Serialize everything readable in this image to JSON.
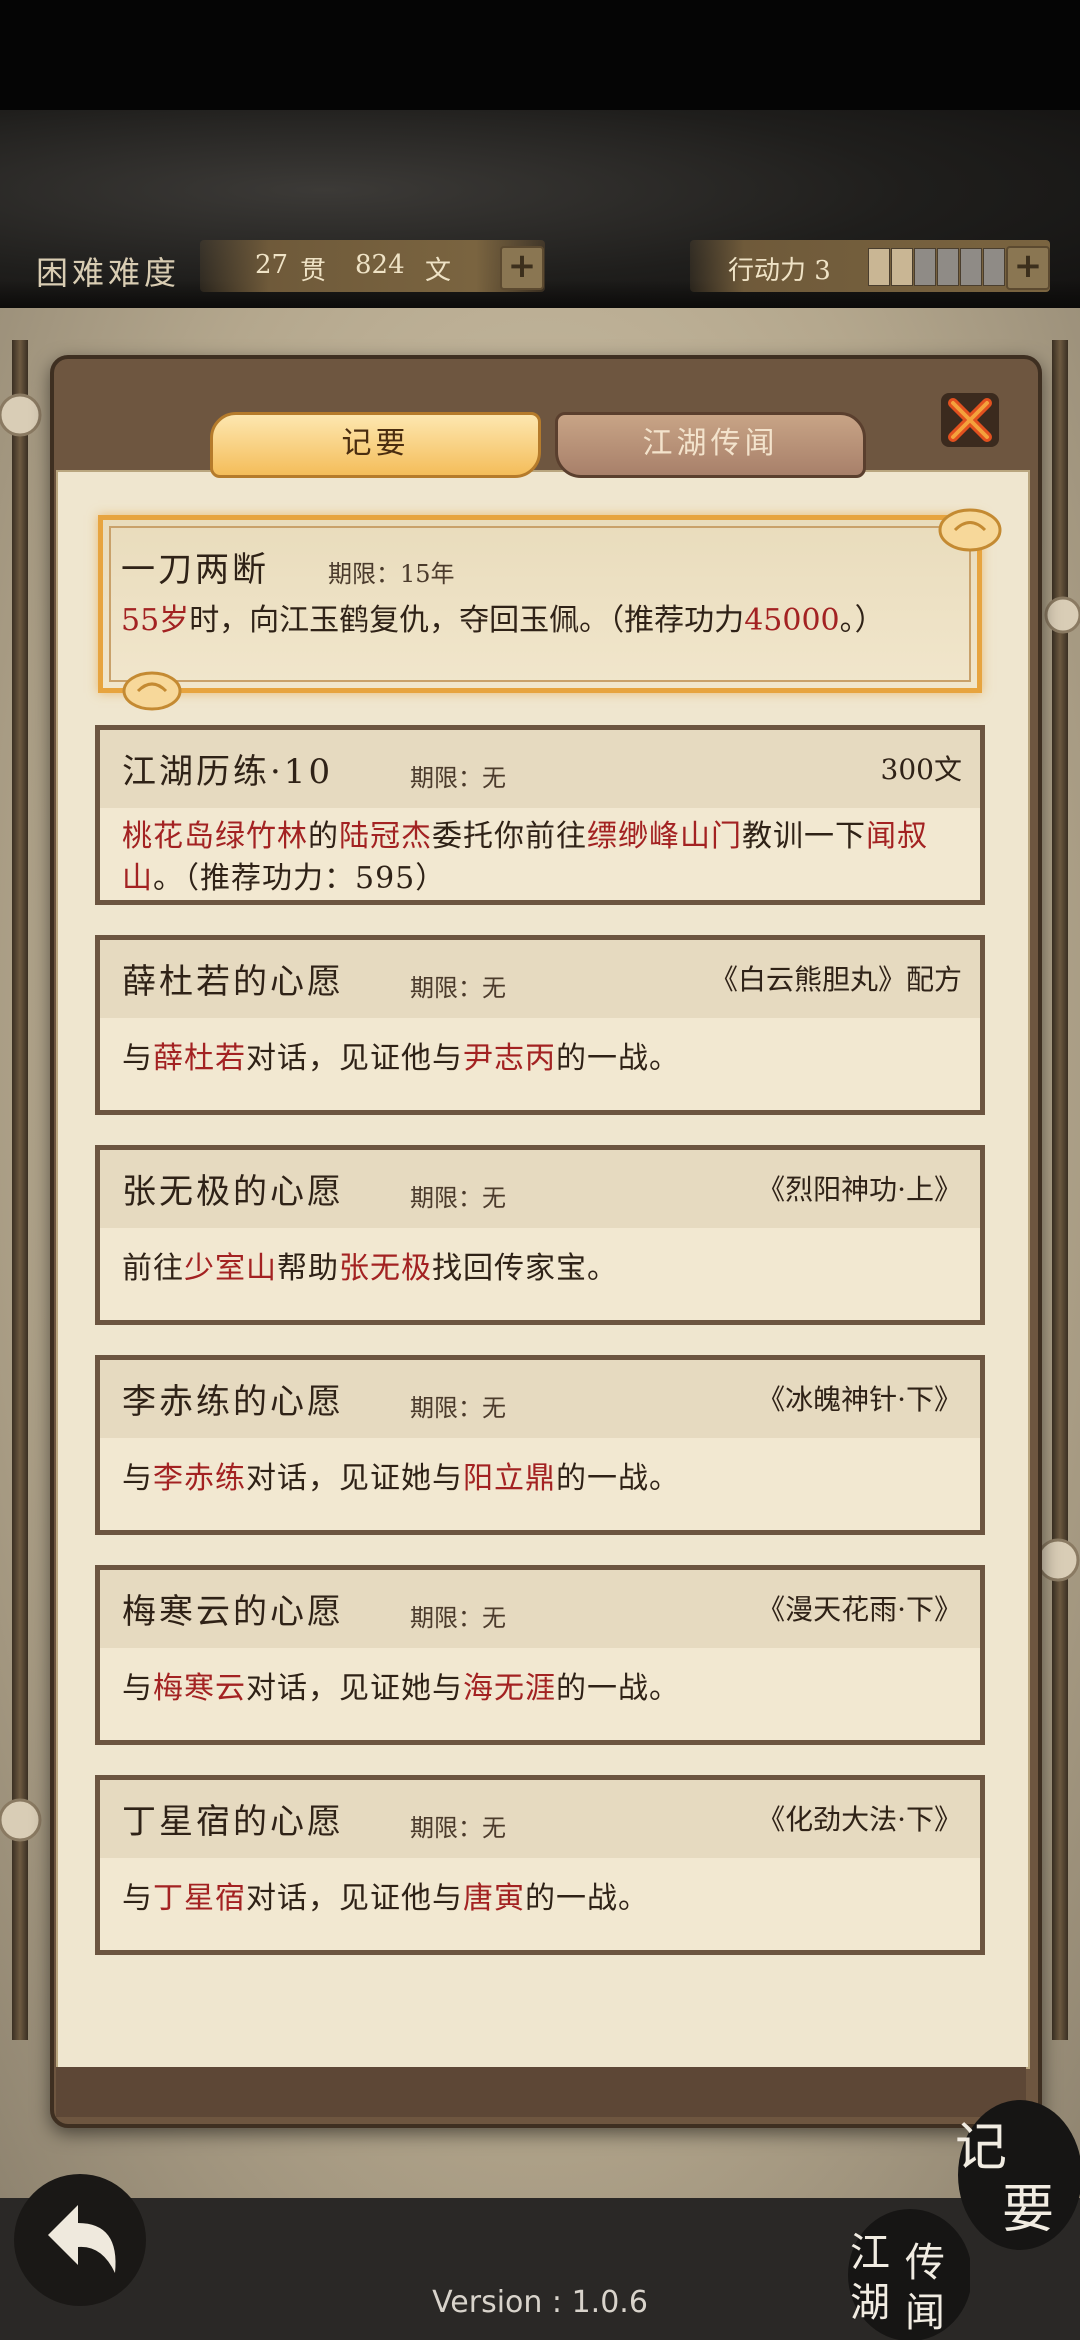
{
  "header": {
    "difficulty": "困难难度",
    "money_guan": "27",
    "money_guan_unit": "贯",
    "money_wen": "824",
    "money_wen_unit": "文",
    "action_label": "行动力 3",
    "action_filled_segments": 2,
    "action_total_segments": 6
  },
  "tabs": {
    "active": "记要",
    "inactive": "江湖传闻"
  },
  "featured": {
    "title": "一刀两断",
    "deadline": "期限：15年",
    "desc_p1": "55岁",
    "desc_p2": "时，向江玉鹤复仇，夺回玉佩。（推荐功力",
    "desc_p3": "45000",
    "desc_p4": "。）"
  },
  "quests": [
    {
      "title": "江湖历练·10",
      "deadline": "期限：无",
      "reward": "300文",
      "desc": [
        "桃花岛绿竹林",
        "的",
        "陆冠杰",
        "委托你前往",
        "缥缈峰山门",
        "教训一下",
        "闻叔山",
        "。（推荐功力：595）"
      ]
    },
    {
      "title": "薛杜若的心愿",
      "deadline": "期限：无",
      "reward": "《白云熊胆丸》配方",
      "desc": [
        "与",
        "薛杜若",
        "对话，见证他与",
        "尹志丙",
        "的一战。"
      ]
    },
    {
      "title": "张无极的心愿",
      "deadline": "期限：无",
      "reward": "《烈阳神功·上》",
      "desc": [
        "前往",
        "少室山",
        "帮助",
        "张无极",
        "找回传家宝。"
      ]
    },
    {
      "title": "李赤练的心愿",
      "deadline": "期限：无",
      "reward": "《冰魄神针·下》",
      "desc": [
        "与",
        "李赤练",
        "对话，见证她与",
        "阳立鼎",
        "的一战。"
      ]
    },
    {
      "title": "梅寒云的心愿",
      "deadline": "期限：无",
      "reward": "《漫天花雨·下》",
      "desc": [
        "与",
        "梅寒云",
        "对话，见证她与",
        "海无涯",
        "的一战。"
      ]
    },
    {
      "title": "丁星宿的心愿",
      "deadline": "期限：无",
      "reward": "《化劲大法·下》",
      "desc": [
        "与",
        "丁星宿",
        "对话，见证他与",
        "唐寅",
        "的一战。"
      ]
    }
  ],
  "footer": {
    "version": "Version : 1.0.6",
    "seal_jiyao_1": "记",
    "seal_jiyao_2": "要",
    "seal_jianghu_1": "江",
    "seal_jianghu_2": "湖",
    "seal_jianghu_3": "传",
    "seal_jianghu_4": "闻"
  },
  "colors": {
    "accent_red": "#a32222",
    "tab_active": "#f4bd5a",
    "card_border": "#6c5540"
  }
}
